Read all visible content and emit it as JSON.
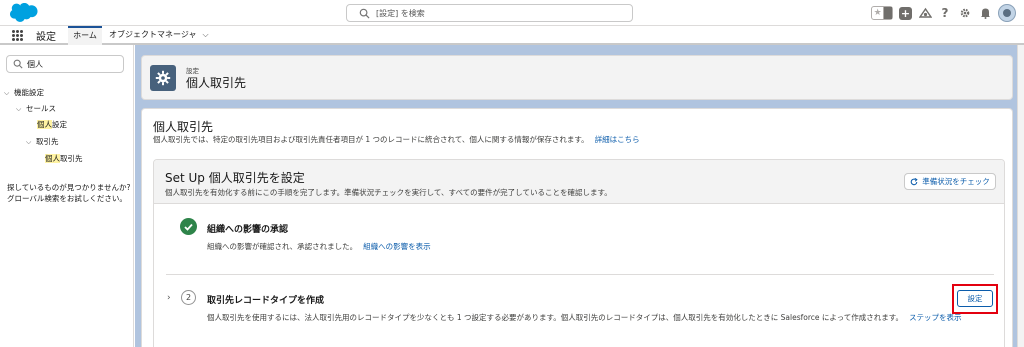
{
  "header": {
    "search_placeholder": "[設定] を検索",
    "icons": [
      "favorites-star-icon",
      "favorites-dropdown-icon",
      "add-icon",
      "trailhead-icon",
      "help-icon",
      "settings-gear-icon",
      "notifications-bell-icon",
      "user-avatar"
    ]
  },
  "nav": {
    "app_name": "設定",
    "tabs": [
      {
        "label": "ホーム",
        "active": true
      },
      {
        "label": "オブジェクトマネージャ",
        "active": false
      }
    ]
  },
  "sidebar": {
    "search_value": "個人",
    "tree": [
      {
        "label": "機能設定",
        "level": 0,
        "expanded": true
      },
      {
        "label": "セールス",
        "level": 1,
        "expanded": true
      },
      {
        "label_highlight": "個人",
        "label_rest": "設定",
        "level": 2
      },
      {
        "label": "取引先",
        "level": 1,
        "expanded": true
      },
      {
        "label_highlight": "個人",
        "label_rest": "取引先",
        "level": 2
      }
    ],
    "help_text": "探しているものが見つかりませんか? グローバル検索をお試しください。"
  },
  "page_header": {
    "eyebrow": "設定",
    "title": "個人取引先"
  },
  "content": {
    "title": "個人取引先",
    "description": "個人取引先では、特定の取引先項目および取引先責任者項目が 1 つのレコードに統合されて、個人に関する情報が保存されます。",
    "description_link": "詳細はこちら",
    "setup": {
      "title": "Set Up 個人取引先を設定",
      "description": "個人取引先を有効化する前にこの手順を完了します。準備状況チェックを実行して、すべての要件が完了していることを確認します。",
      "check_button": "準備状況をチェック",
      "steps": [
        {
          "status": "complete",
          "title": "組織への影響の承認",
          "description": "組織への影響が確認され、承認されました。",
          "link": "組織への影響を表示"
        },
        {
          "status": "pending",
          "number": "2",
          "title": "取引先レコードタイプを作成",
          "description": "個人取引先を使用するには、法人取引先用のレコードタイプを少なくとも 1 つ設定する必要があります。個人取引先のレコードタイプは、個人取引先を有効化したときに Salesforce によって作成されます。",
          "link": "ステップを表示",
          "button": "設定"
        }
      ]
    }
  },
  "colors": {
    "brand_blue": "#0b5cab",
    "header_logo": "#00a1e0",
    "complete_green": "#2e844a",
    "highlight_yellow": "#fff3a3",
    "annotation_red": "#e3000f",
    "page_bg": "#b0c4df"
  }
}
